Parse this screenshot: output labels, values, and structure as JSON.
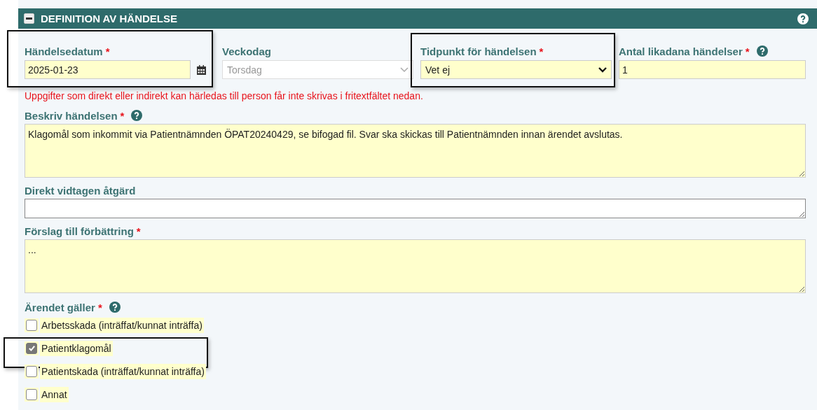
{
  "section": {
    "title": "DEFINITION AV HÄNDELSE",
    "expanded": true
  },
  "top_fields": [
    {
      "kind": "date",
      "label": "Händelsedatum",
      "required_mark": "*",
      "value": "2025-01-23",
      "highlighted": true
    },
    {
      "kind": "select",
      "label": "Veckodag",
      "value": "Torsdag",
      "disabled": true
    },
    {
      "kind": "select",
      "label": "Tidpunkt för händelsen",
      "required_mark": "*",
      "value": "Vet ej",
      "highlighted": true
    },
    {
      "kind": "text",
      "label": "Antal likadana händelser",
      "required_mark": "*",
      "help": true,
      "value": "1"
    }
  ],
  "warning": "Uppgifter som direkt eller indirekt kan härledas till person får inte skrivas i fritextfältet nedan.",
  "text_fields": [
    {
      "kind": "textarea",
      "label": "Beskriv händelsen",
      "required_mark": "*",
      "help": true,
      "value": "Klagomål som inkommit via Patientnämnden ÖPAT20240429, se bifogad fil. Svar ska skickas till Patientnämnden innan ärendet avslutas."
    },
    {
      "kind": "input",
      "label": "Direkt vidtagen åtgärd"
    },
    {
      "kind": "textarea",
      "label": "Förslag till förbättring",
      "required_mark": "*",
      "value": "..."
    }
  ],
  "checkbox_group": {
    "label": "Ärendet gäller",
    "required_mark": "*",
    "help": true,
    "options": [
      {
        "label": "Arbetsskada (inträffat/kunnat inträffa)",
        "checked": false
      },
      {
        "label": "Patientklagomål",
        "checked": true,
        "highlighted": true
      },
      {
        "label": "Patientskada (inträffat/kunnat inträffa)",
        "checked": false
      },
      {
        "label": "Annat",
        "checked": false
      }
    ]
  }
}
